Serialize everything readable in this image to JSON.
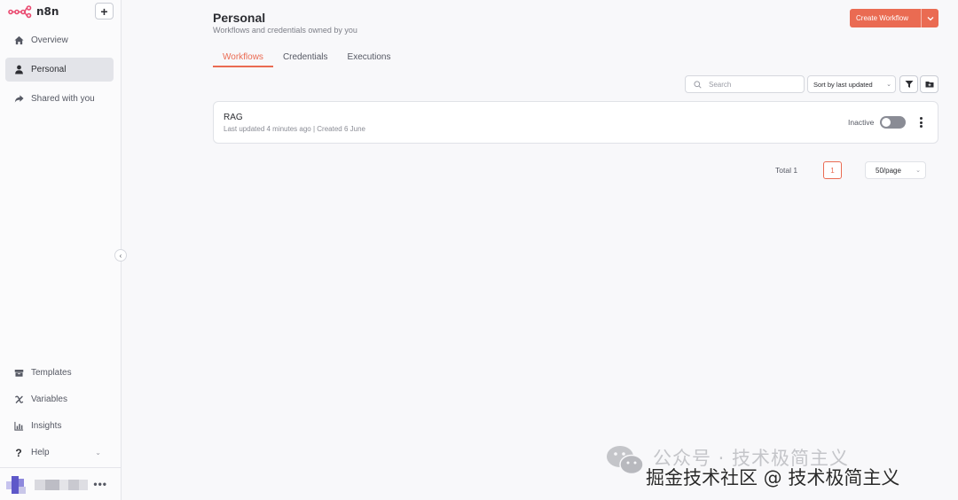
{
  "app": {
    "name": "n8n",
    "brand_color": "#ea6b52"
  },
  "sidebar": {
    "add_label": "+",
    "top_items": [
      {
        "label": "Overview",
        "icon": "home-icon"
      },
      {
        "label": "Personal",
        "icon": "user-icon",
        "active": true
      },
      {
        "label": "Shared with you",
        "icon": "share-icon"
      }
    ],
    "bottom_items": [
      {
        "label": "Templates",
        "icon": "box-icon"
      },
      {
        "label": "Variables",
        "icon": "variable-icon"
      },
      {
        "label": "Insights",
        "icon": "chart-icon"
      },
      {
        "label": "Help",
        "icon": "question-icon"
      }
    ],
    "more_label": "•••"
  },
  "header": {
    "title": "Personal",
    "subtitle": "Workflows and credentials owned by you",
    "create_label": "Create Workflow"
  },
  "tabs": [
    {
      "label": "Workflows",
      "active": true
    },
    {
      "label": "Credentials"
    },
    {
      "label": "Executions"
    }
  ],
  "toolbar": {
    "search_placeholder": "Search",
    "sort_label": "Sort by last updated"
  },
  "workflows": [
    {
      "name": "RAG",
      "meta": "Last updated 4 minutes ago | Created 6 June",
      "status": "Inactive",
      "active": false
    }
  ],
  "pagination": {
    "total": "Total 1",
    "current_page": "1",
    "page_size": "50/page"
  },
  "watermark": {
    "line1": "公众号 · 技术极简主义",
    "line2": "掘金技术社区 @ 技术极简主义"
  }
}
